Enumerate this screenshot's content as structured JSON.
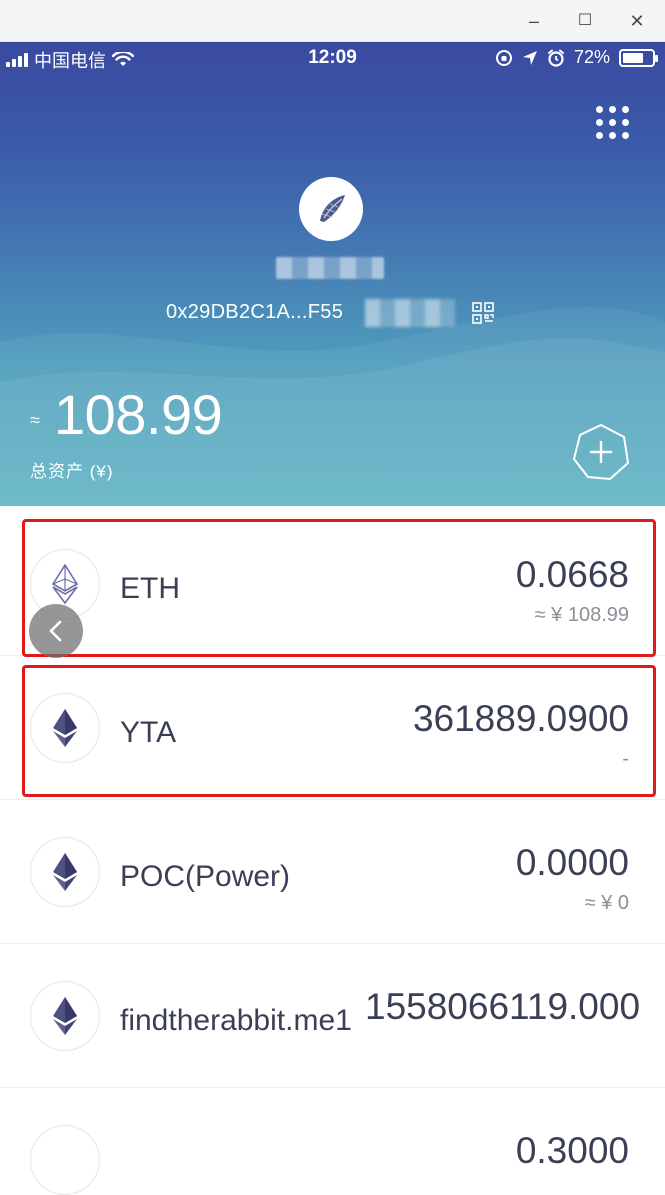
{
  "window": {
    "minimize": "–",
    "maximize": "☐",
    "close": "✕"
  },
  "status_bar": {
    "carrier": "中国电信",
    "time": "12:09",
    "battery": "72%"
  },
  "wallet": {
    "address": "0x29DB2C1A...F55",
    "total_approx": "≈",
    "total_value": "108.99",
    "total_label": "总资产 (¥)"
  },
  "tokens": [
    {
      "name": "ETH",
      "amount": "0.0668",
      "value": "≈ ¥ 108.99"
    },
    {
      "name": "YTA",
      "amount": "361889.0900",
      "value": "-"
    },
    {
      "name": "POC(Power)",
      "amount": "0.0000",
      "value": "≈ ¥ 0"
    },
    {
      "name": "findtherabbit.me1",
      "amount": "1558066119.000",
      "value": ""
    },
    {
      "name": "",
      "amount": "0.3000",
      "value": ""
    }
  ],
  "colors": {
    "header_top": "#3a4aa0",
    "header_bottom": "#5bb2c2",
    "highlight": "#e0191b",
    "text": "#3b3f55"
  },
  "icons": {
    "menu": "grid-menu-icon",
    "avatar": "shell-logo-icon",
    "qr": "qr-code-icon",
    "add": "add-token-icon",
    "coin": "ethereum-icon",
    "back": "back-arrow-icon"
  }
}
